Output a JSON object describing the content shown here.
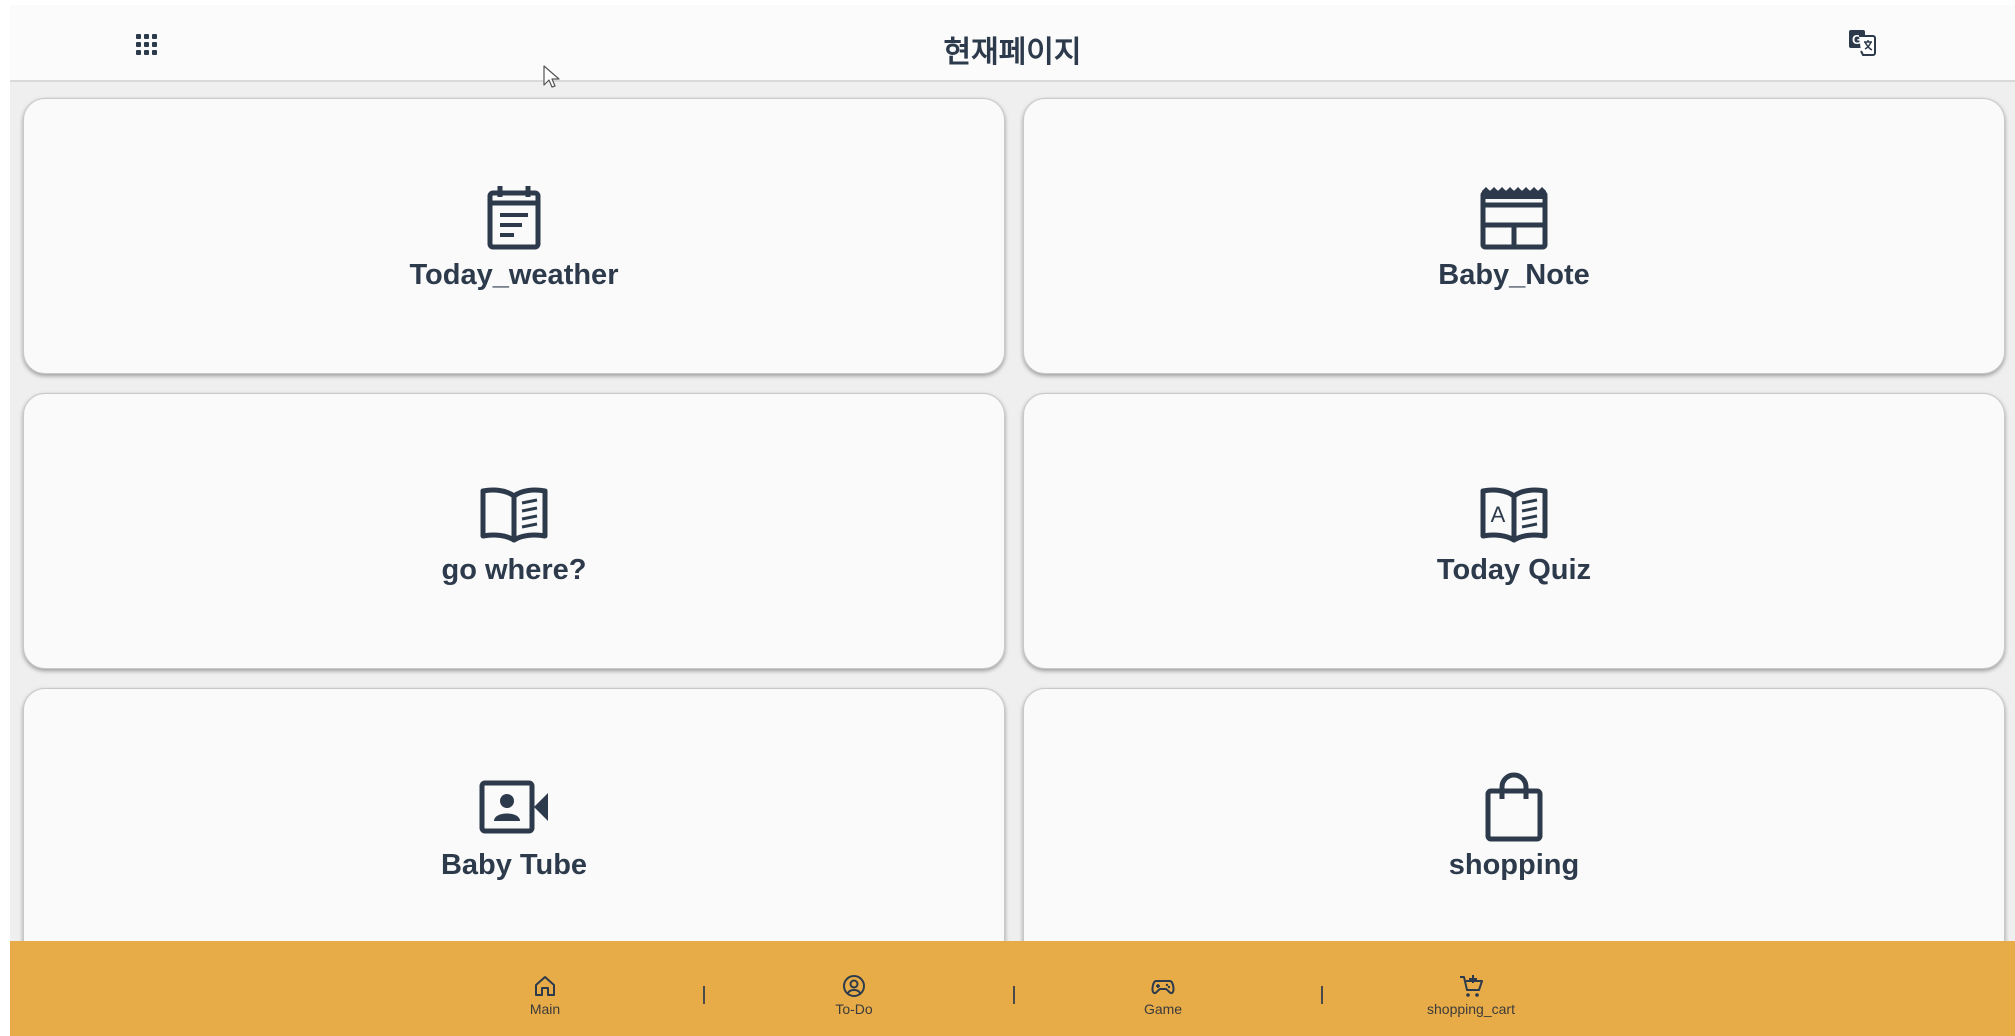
{
  "header": {
    "title": "현재페이지",
    "menu_icon": "apps-grid-icon",
    "translate_icon": "translate-icon"
  },
  "cards": [
    {
      "label": "Today_weather",
      "icon": "calendar-note-icon"
    },
    {
      "label": "Baby_Note",
      "icon": "notebook-table-icon"
    },
    {
      "label": "go where?",
      "icon": "open-book-icon"
    },
    {
      "label": "Today Quiz",
      "icon": "quiz-book-icon"
    },
    {
      "label": "Baby Tube",
      "icon": "video-person-icon"
    },
    {
      "label": "shopping",
      "icon": "shopping-bag-icon"
    }
  ],
  "bottom_nav": [
    {
      "label": "Main",
      "icon": "home-icon"
    },
    {
      "label": "To-Do",
      "icon": "user-circle-icon"
    },
    {
      "label": "Game",
      "icon": "gamepad-icon"
    },
    {
      "label": "shopping_cart",
      "icon": "add-cart-icon"
    }
  ],
  "colors": {
    "bottom_bar": "#e7ac48",
    "icon": "#2c3a4b",
    "card": "#fafafa"
  }
}
